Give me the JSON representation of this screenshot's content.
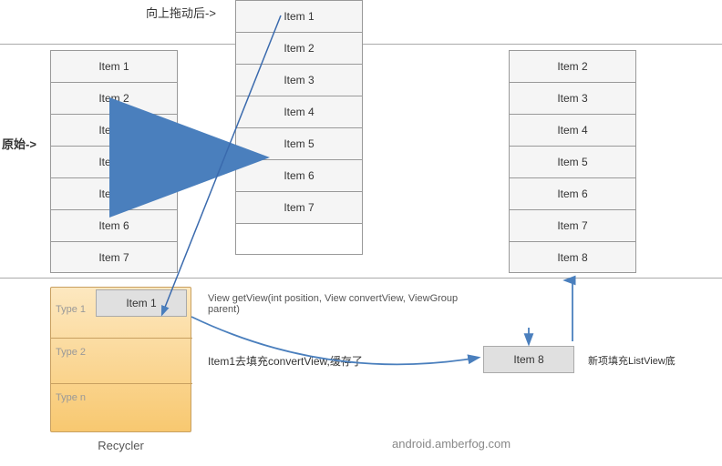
{
  "labels": {
    "original": "原始->",
    "after_drag": "向上拖动后->",
    "recycler": "Recycler",
    "website": "android.amberfog.com",
    "getview": "View getView(int position, View convertView, ViewGroup parent)",
    "item1_fill": "Item1去填充convertView,缓存了",
    "new_fill": "新项填充ListView底"
  },
  "lists": {
    "original": [
      "Item 1",
      "Item 2",
      "Item 3",
      "Item 4",
      "Item 5",
      "Item 6",
      "Item 7"
    ],
    "middle": [
      "Item 1",
      "Item 2",
      "Item 3",
      "Item 4",
      "Item 5",
      "Item 6",
      "Item 7",
      ""
    ],
    "right": [
      "Item 2",
      "Item 3",
      "Item 4",
      "Item 5",
      "Item 6",
      "Item 7",
      "Item 8"
    ]
  },
  "recycler_types": [
    "Type 1",
    "Type 2",
    "Type n"
  ],
  "recycler_item": "Item 1",
  "item8": "Item 8"
}
